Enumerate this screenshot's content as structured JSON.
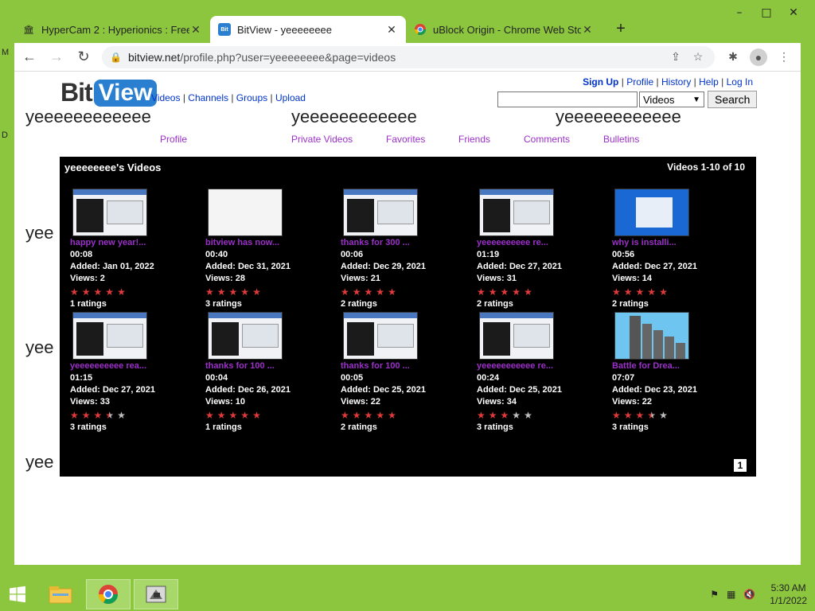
{
  "browser": {
    "tabs": [
      {
        "title": "HyperCam 2 : Hyperionics : Free",
        "icon": "archive-icon",
        "active": false
      },
      {
        "title": "BitView - yeeeeeeee",
        "icon": "bitview-icon",
        "active": true
      },
      {
        "title": "uBlock Origin - Chrome Web Sto",
        "icon": "chrome-webstore-icon",
        "active": false
      }
    ],
    "url_domain": "bitview.net",
    "url_path": "/profile.php?user=yeeeeeeee&page=videos"
  },
  "site": {
    "logo_bit": "Bit",
    "logo_view": "View",
    "nav": [
      "Videos",
      "Channels",
      "Groups",
      "Upload"
    ],
    "user_links": [
      "Sign Up",
      "Profile",
      "History",
      "Help",
      "Log In"
    ],
    "search_placeholder": "",
    "search_scope": "Videos",
    "search_button": "Search"
  },
  "background_text": [
    "yeeeeeeeeeeee",
    "yeeeeeeeeeeee",
    "yeeeeeeeeeeee",
    "yee",
    "yee",
    "yee"
  ],
  "profile_nav": [
    "Profile",
    "Private Videos",
    "Favorites",
    "Friends",
    "Comments",
    "Bulletins"
  ],
  "videos_box": {
    "title": "yeeeeeeee's Videos",
    "count": "Videos 1-10 of 10",
    "page": "1"
  },
  "videos": [
    {
      "title": "happy new year!...",
      "duration": "00:08",
      "added": "Added: Jan 01, 2022",
      "views": "Views: 2",
      "stars": 5,
      "ratings": "1 ratings",
      "thumb": "screen"
    },
    {
      "title": "bitview has now...",
      "duration": "00:40",
      "added": "Added: Dec 31, 2021",
      "views": "Views: 28",
      "stars": 5,
      "ratings": "3 ratings",
      "thumb": "white"
    },
    {
      "title": "thanks for 300 ...",
      "duration": "00:06",
      "added": "Added: Dec 29, 2021",
      "views": "Views: 21",
      "stars": 5,
      "ratings": "2 ratings",
      "thumb": "screen"
    },
    {
      "title": "yeeeeeeeeee re...",
      "duration": "01:19",
      "added": "Added: Dec 27, 2021",
      "views": "Views: 31",
      "stars": 5,
      "ratings": "2 ratings",
      "thumb": "screen"
    },
    {
      "title": "why is installi...",
      "duration": "00:56",
      "added": "Added: Dec 27, 2021",
      "views": "Views: 14",
      "stars": 5,
      "ratings": "2 ratings",
      "thumb": "blue"
    },
    {
      "title": "yeeeeeeeeee rea...",
      "duration": "01:15",
      "added": "Added: Dec 27, 2021",
      "views": "Views: 33",
      "stars": 3.5,
      "ratings": "3 ratings",
      "thumb": "screen"
    },
    {
      "title": "thanks for 100 ...",
      "duration": "00:04",
      "added": "Added: Dec 26, 2021",
      "views": "Views: 10",
      "stars": 5,
      "ratings": "1 ratings",
      "thumb": "screen"
    },
    {
      "title": "thanks for 100 ...",
      "duration": "00:05",
      "added": "Added: Dec 25, 2021",
      "views": "Views: 22",
      "stars": 5,
      "ratings": "2 ratings",
      "thumb": "screen"
    },
    {
      "title": "yeeeeeeeeeee re...",
      "duration": "00:24",
      "added": "Added: Dec 25, 2021",
      "views": "Views: 34",
      "stars": 3,
      "ratings": "3 ratings",
      "thumb": "screen"
    },
    {
      "title": "Battle for Drea...",
      "duration": "07:07",
      "added": "Added: Dec 23, 2021",
      "views": "Views: 22",
      "stars": 3.5,
      "ratings": "3 ratings",
      "thumb": "sky"
    }
  ],
  "taskbar": {
    "apps": [
      "file-explorer-icon",
      "chrome-icon",
      "hypercam-icon"
    ],
    "time": "5:30 AM",
    "date": "1/1/2022"
  },
  "desktop_fragments": [
    "M",
    "D"
  ],
  "colors": {
    "accent": "#8cc63f",
    "link": "#0033cc",
    "purple": "#9b30c8",
    "star": "#e03a3a"
  }
}
